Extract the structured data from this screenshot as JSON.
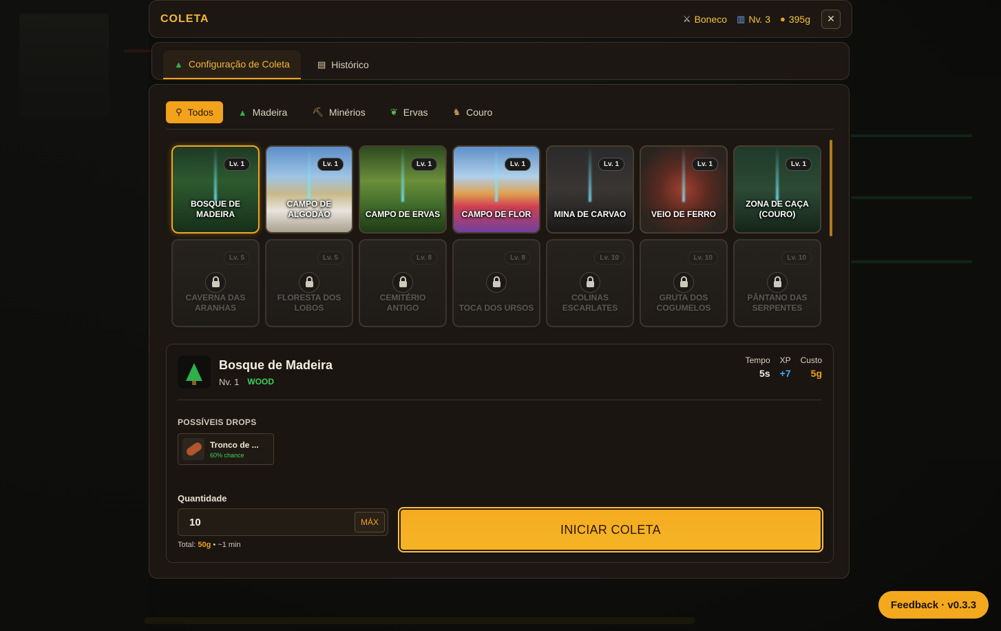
{
  "header": {
    "title": "COLETA",
    "character": "Boneco",
    "level": "Nv. 3",
    "gold": "395g",
    "close": "✕"
  },
  "tabs": [
    {
      "label": "Configuração de Coleta",
      "icon": "tree-icon",
      "active": true
    },
    {
      "label": "Histórico",
      "icon": "scroll-icon",
      "active": false
    }
  ],
  "filters": [
    {
      "label": "Todos",
      "icon": "search-icon",
      "active": true
    },
    {
      "label": "Madeira",
      "icon": "tree-icon"
    },
    {
      "label": "Minérios",
      "icon": "pickaxe-icon"
    },
    {
      "label": "Ervas",
      "icon": "herb-icon"
    },
    {
      "label": "Couro",
      "icon": "deer-icon"
    }
  ],
  "locations": [
    {
      "name": "BOSQUE DE MADEIRA",
      "level": "Lv. 1",
      "locked": false,
      "selected": true
    },
    {
      "name": "CAMPO DE ALGODÃO",
      "level": "Lv. 1",
      "locked": false
    },
    {
      "name": "CAMPO DE ERVAS",
      "level": "Lv. 1",
      "locked": false
    },
    {
      "name": "CAMPO DE FLOR",
      "level": "Lv. 1",
      "locked": false
    },
    {
      "name": "MINA DE CARVAO",
      "level": "Lv. 1",
      "locked": false
    },
    {
      "name": "VEIO DE FERRO",
      "level": "Lv. 1",
      "locked": false
    },
    {
      "name": "ZONA DE CAÇA (COURO)",
      "level": "Lv. 1",
      "locked": false
    },
    {
      "name": "CAVERNA DAS ARANHAS",
      "level": "Lv. 5",
      "locked": true
    },
    {
      "name": "FLORESTA DOS LOBOS",
      "level": "Lv. 5",
      "locked": true
    },
    {
      "name": "CEMITÉRIO ANTIGO",
      "level": "Lv. 8",
      "locked": true
    },
    {
      "name": "TOCA DOS URSOS",
      "level": "Lv. 8",
      "locked": true
    },
    {
      "name": "COLINAS ESCARLATES",
      "level": "Lv. 10",
      "locked": true
    },
    {
      "name": "GRUTA DOS COGUMELOS",
      "level": "Lv. 10",
      "locked": true
    },
    {
      "name": "PÂNTANO DAS SERPENTES",
      "level": "Lv. 10",
      "locked": true
    }
  ],
  "detail": {
    "name": "Bosque de Madeira",
    "level": "Nv. 1",
    "type": "WOOD",
    "stats": [
      {
        "label": "Tempo",
        "value": "5s",
        "color": "#f5efe2"
      },
      {
        "label": "XP",
        "value": "+7",
        "color": "#4aa8f0"
      },
      {
        "label": "Custo",
        "value": "5g",
        "color": "#f3a21b"
      }
    ],
    "drops_label": "POSSÍVEIS DROPS",
    "drops": [
      {
        "name": "Tronco de ...",
        "chance": "60% chance"
      }
    ],
    "quantity_label": "Quantidade",
    "quantity": "10",
    "max_label": "MÁX",
    "total_prefix": "Total:",
    "total_gold": "50g",
    "total_suffix": "• ~1 min",
    "start_label": "INICIAR COLETA"
  },
  "feedback": "Feedback · v0.3.3"
}
